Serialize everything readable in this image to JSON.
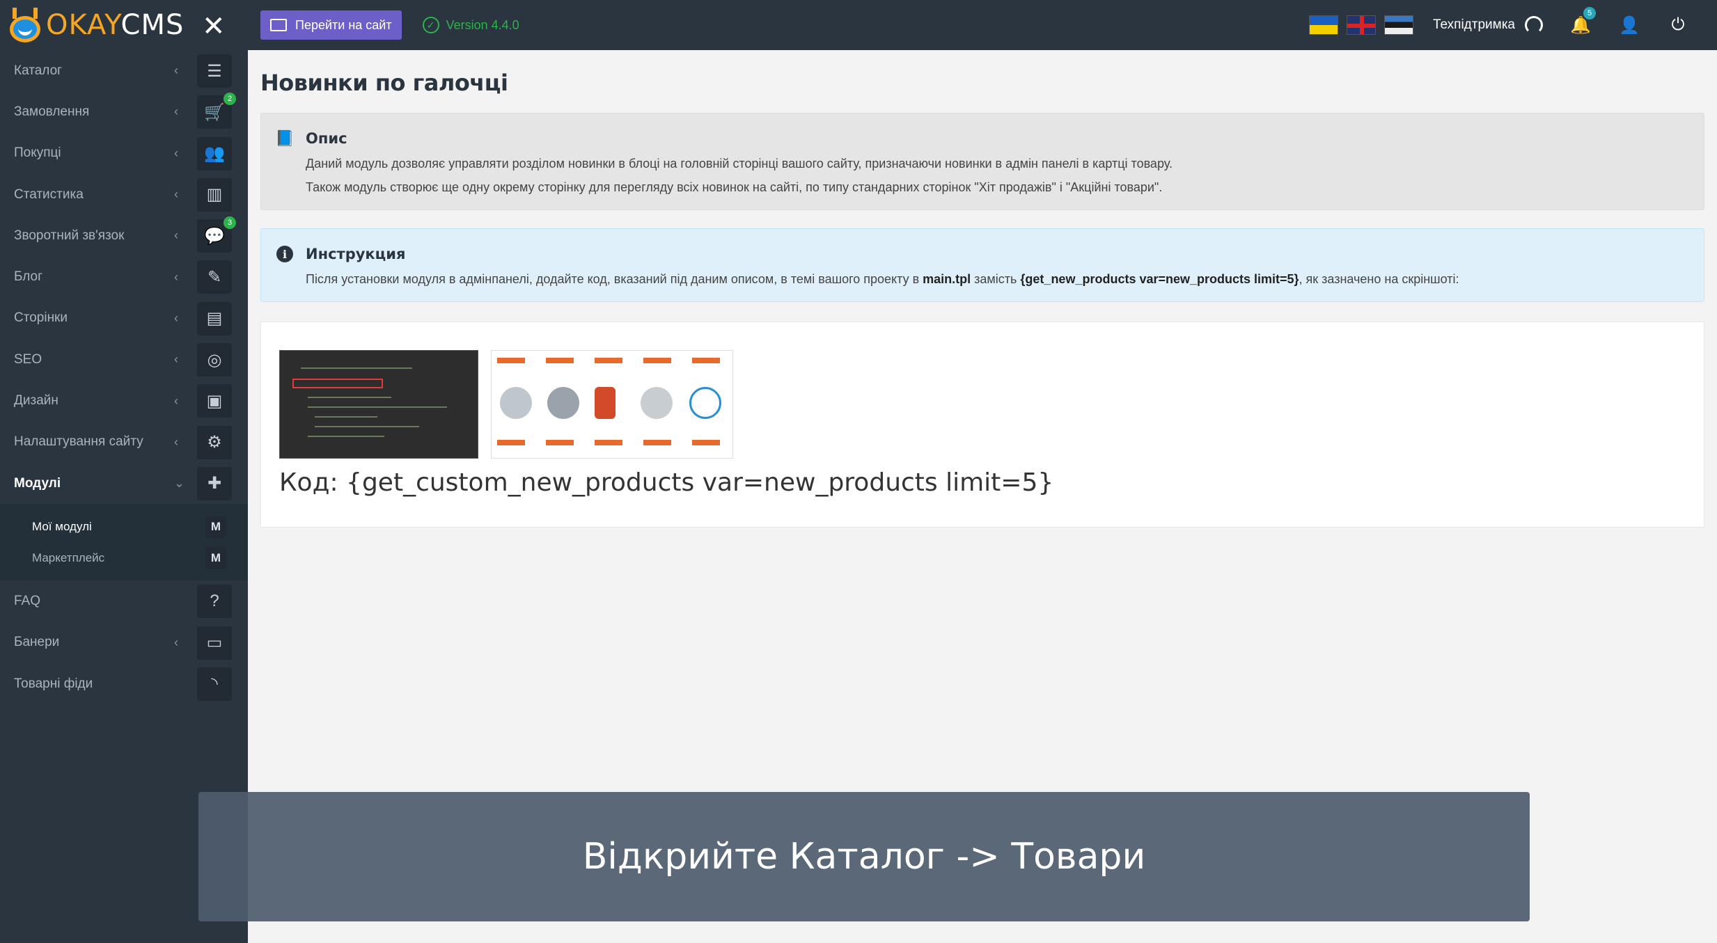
{
  "brand": {
    "okay": "OKAY",
    "cms": "CMS"
  },
  "topbar": {
    "site_button": "Перейти на сайт",
    "version": "Version 4.4.0",
    "support": "Техпідтримка",
    "notifications_count": "5"
  },
  "sidebar": {
    "items": [
      {
        "label": "Каталог",
        "icon": "list-icon"
      },
      {
        "label": "Замовлення",
        "icon": "cart-icon",
        "badge": "2"
      },
      {
        "label": "Покупці",
        "icon": "users-icon"
      },
      {
        "label": "Статистика",
        "icon": "bar-chart-icon"
      },
      {
        "label": "Зворотний зв'язок",
        "icon": "comments-icon",
        "badge": "3"
      },
      {
        "label": "Блог",
        "icon": "pencil-icon"
      },
      {
        "label": "Сторінки",
        "icon": "pages-icon"
      },
      {
        "label": "SEO",
        "icon": "target-icon"
      },
      {
        "label": "Дизайн",
        "icon": "design-icon"
      },
      {
        "label": "Налаштування сайту",
        "icon": "gear-icon"
      },
      {
        "label": "Модулі",
        "icon": "puzzle-icon"
      }
    ],
    "submenu": [
      {
        "label": "Мої модулі",
        "badge": "M"
      },
      {
        "label": "Маркетплейс",
        "badge": "M"
      }
    ],
    "bottom_items": [
      {
        "label": "FAQ",
        "icon": "question-icon"
      },
      {
        "label": "Банери",
        "icon": "banner-icon"
      },
      {
        "label": "Товарні фіди",
        "icon": "rss-icon"
      }
    ]
  },
  "page": {
    "title": "Новинки по галочці",
    "description": {
      "heading": "Опис",
      "line1": "Даний модуль дозволяє управляти розділом новинки в блоці на головній сторінці вашого сайту, призначаючи новинки в адмін панелі в картці товару.",
      "line2": "Також модуль створює ще одну окрему сторінку для перегляду всіх новинок на сайті, по типу стандарних сторінок \"Хіт продажів\" і \"Акційні товари\"."
    },
    "instruction": {
      "heading": "Инструкция",
      "part1": "Після установки модуля в адмінпанелі, додайте код, вказаний під даним описом, в темі вашого проекту в ",
      "file": "main.tpl",
      "part2": " замість ",
      "code": "{get_new_products var=new_products limit=5}",
      "part3": ", як зазначено на скріншоті:"
    },
    "code_line": "Код: {get_custom_new_products var=new_products limit=5}"
  },
  "caption": "Відкрийте Каталог -> Товари"
}
